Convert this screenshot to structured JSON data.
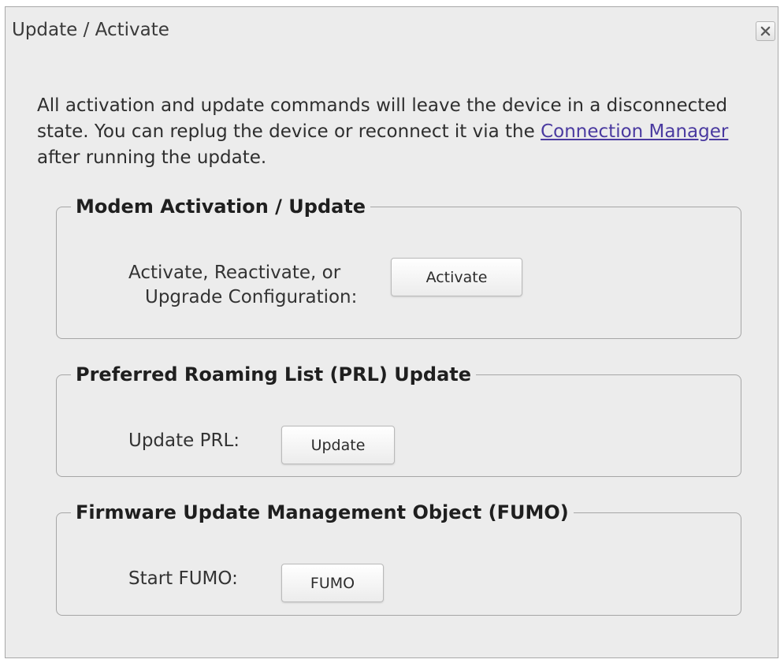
{
  "dialog": {
    "title": "Update / Activate",
    "close_label": "close"
  },
  "intro": {
    "text_before": "All activation and update commands will leave the device in a disconnected state. You can replug the device or reconnect it via the ",
    "link_text": "Connection Manager",
    "text_after": " after running the update."
  },
  "modem": {
    "legend": "Modem Activation / Update",
    "label_line1": "Activate, Reactivate, or",
    "label_line2": "Upgrade Configuration:",
    "button": "Activate"
  },
  "prl": {
    "legend": "Preferred Roaming List (PRL) Update",
    "label": "Update PRL:",
    "button": "Update"
  },
  "fumo": {
    "legend": "Firmware Update Management Object (FUMO)",
    "label": "Start FUMO:",
    "button": "FUMO"
  }
}
